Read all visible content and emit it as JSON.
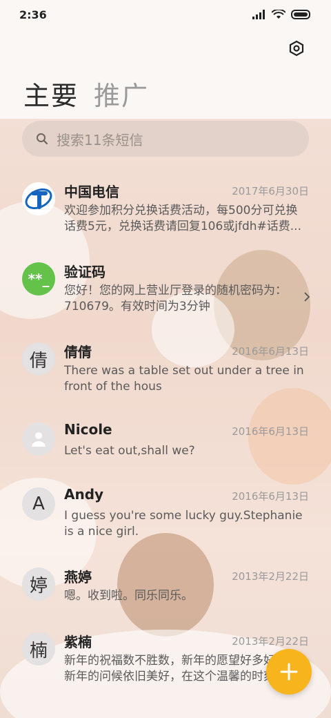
{
  "status": {
    "time": "2:36"
  },
  "tabs": {
    "primary": "主要",
    "promo": "推广"
  },
  "search": {
    "placeholder": "搜索11条短信"
  },
  "threads": [
    {
      "avatar_type": "logo",
      "avatar_text": "",
      "name": "中国电信",
      "date": "2017年6月30日",
      "preview": "欢迎参加积分兑换话费活动，每500分可兑换话费5元，兑换话费请回复106或jfdh#话费..."
    },
    {
      "avatar_type": "code",
      "avatar_text": "**_",
      "name": "验证码",
      "date": "",
      "preview": "您好！您的网上营业厅登录的随机密码为：710679。有效时间为3分钟"
    },
    {
      "avatar_type": "letter",
      "avatar_text": "倩",
      "name": "倩倩",
      "date": "2016年6月13日",
      "preview": "There was a table set out under a tree in front of the hous"
    },
    {
      "avatar_type": "person",
      "avatar_text": "",
      "name": "Nicole",
      "date": "2016年6月13日",
      "preview": "Let's eat out,shall we?"
    },
    {
      "avatar_type": "letter",
      "avatar_text": "A",
      "name": "Andy",
      "date": "2016年6月13日",
      "preview": "I guess you're some lucky guy.Stephanie is a nice girl."
    },
    {
      "avatar_type": "letter",
      "avatar_text": "婷",
      "name": "燕婷",
      "date": "2013年2月22日",
      "preview": "嗯。收到啦。同乐同乐。"
    },
    {
      "avatar_type": "letter",
      "avatar_text": "楠",
      "name": "紫楠",
      "date": "2013年2月22日",
      "preview": "新年的祝福数不胜数，新年的愿望好多好多，新年的问候依旧美好，在这个温馨的时刻..."
    }
  ],
  "icons": {
    "settings": "settings-hexagon-icon",
    "search": "search-icon",
    "compose": "plus-icon"
  },
  "colors": {
    "fab": "#f7b41c",
    "code_avatar": "#64c24a"
  }
}
